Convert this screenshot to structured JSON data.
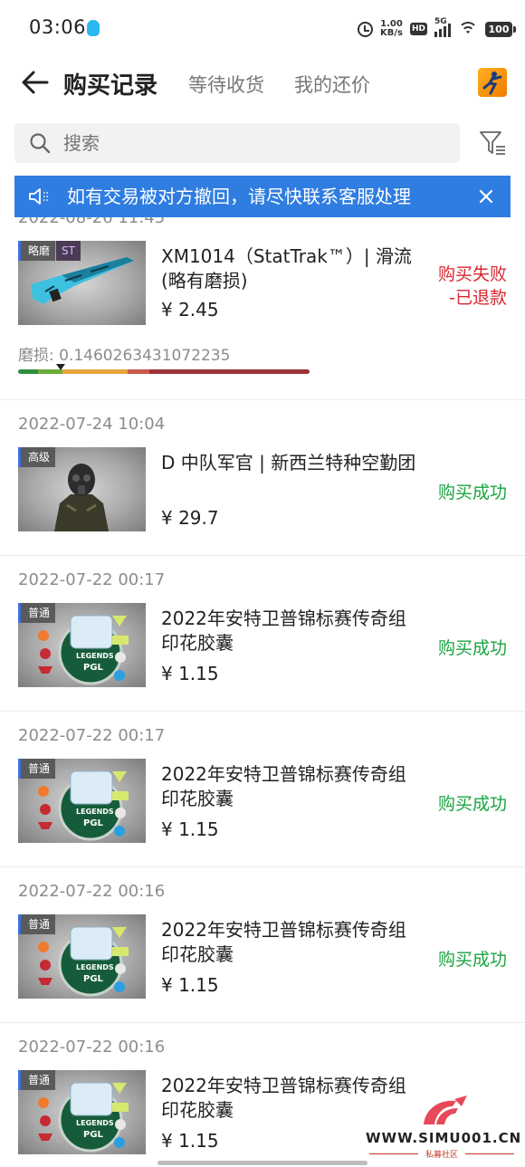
{
  "status_bar": {
    "time": "03:06",
    "net_speed_value": "1.00",
    "net_speed_unit": "KB/s",
    "hd": "HD",
    "network": "5G",
    "battery": "100"
  },
  "header": {
    "title": "购买记录",
    "tabs": [
      {
        "label": "等待收货"
      },
      {
        "label": "我的还价"
      }
    ]
  },
  "search": {
    "placeholder": "搜索"
  },
  "notice": {
    "text": "如有交易被对方撤回，请尽快联系客服处理"
  },
  "orders": [
    {
      "date": "2022-08-26 11:45",
      "tag": "略磨",
      "tag2": "ST",
      "name": "XM1014（StatTrak™）| 滑流(略有磨损)",
      "price": "¥ 2.45",
      "status": "购买失败-已退款",
      "status_type": "fail",
      "wear_label": "磨损:",
      "wear_value": "0.1460263431072235",
      "wear_fraction": 0.146
    },
    {
      "date": "2022-07-24 10:04",
      "tag": "高级",
      "name": "D 中队军官 | 新西兰特种空勤团",
      "price": "¥ 29.7",
      "status": "购买成功",
      "status_type": "ok"
    },
    {
      "date": "2022-07-22 00:17",
      "tag": "普通",
      "name": "2022年安特卫普锦标赛传奇组印花胶囊",
      "price": "¥ 1.15",
      "status": "购买成功",
      "status_type": "ok"
    },
    {
      "date": "2022-07-22 00:17",
      "tag": "普通",
      "name": "2022年安特卫普锦标赛传奇组印花胶囊",
      "price": "¥ 1.15",
      "status": "购买成功",
      "status_type": "ok"
    },
    {
      "date": "2022-07-22 00:16",
      "tag": "普通",
      "name": "2022年安特卫普锦标赛传奇组印花胶囊",
      "price": "¥ 1.15",
      "status": "购买成功",
      "status_type": "ok"
    },
    {
      "date": "2022-07-22 00:16",
      "tag": "普通",
      "name": "2022年安特卫普锦标赛传奇组印花胶囊",
      "price": "¥ 1.15",
      "status": "",
      "status_type": "ok"
    }
  ],
  "capsule": {
    "line1": "LEGENDS",
    "line2": "PGL"
  },
  "watermark": {
    "text": "WWW.SIMU001.CN",
    "sub": "私募社区"
  },
  "colors": {
    "accent": "#2f7de1",
    "success": "#1aa341",
    "fail": "#d8262f"
  }
}
